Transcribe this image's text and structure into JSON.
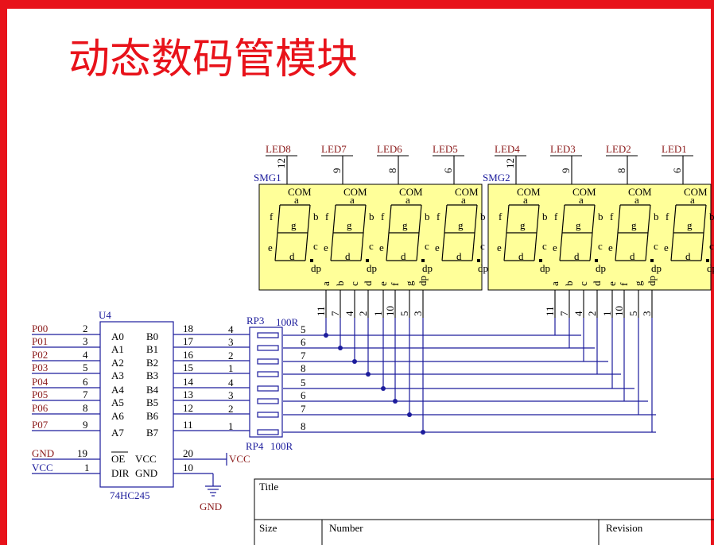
{
  "page_title": "动态数码管模块",
  "displays": [
    {
      "name": "SMG1",
      "leds": [
        "LED8",
        "LED7",
        "LED6",
        "LED5"
      ],
      "com_pins": [
        "12",
        "9",
        "8",
        "6"
      ]
    },
    {
      "name": "SMG2",
      "leds": [
        "LED4",
        "LED3",
        "LED2",
        "LED1"
      ],
      "com_pins": [
        "12",
        "9",
        "8",
        "6"
      ]
    }
  ],
  "digit_labels": {
    "com": "COM",
    "a": "a",
    "b": "b",
    "c": "c",
    "d": "d",
    "e": "e",
    "f": "f",
    "g": "g",
    "dp": "dp"
  },
  "segment_pins": [
    {
      "seg": "a",
      "pin": "11"
    },
    {
      "seg": "b",
      "pin": "7"
    },
    {
      "seg": "c",
      "pin": "4"
    },
    {
      "seg": "d",
      "pin": "2"
    },
    {
      "seg": "e",
      "pin": "1"
    },
    {
      "seg": "f",
      "pin": "10"
    },
    {
      "seg": "g",
      "pin": "5"
    },
    {
      "seg": "dp",
      "pin": "3"
    }
  ],
  "chip": {
    "ref": "U4",
    "part": "74HC245",
    "left_pins": [
      {
        "net": "P00",
        "num": "2",
        "name": "A0"
      },
      {
        "net": "P01",
        "num": "3",
        "name": "A1"
      },
      {
        "net": "P02",
        "num": "4",
        "name": "A2"
      },
      {
        "net": "P03",
        "num": "5",
        "name": "A3"
      },
      {
        "net": "P04",
        "num": "6",
        "name": "A4"
      },
      {
        "net": "P05",
        "num": "7",
        "name": "A5"
      },
      {
        "net": "P06",
        "num": "8",
        "name": "A6"
      },
      {
        "net": "P07",
        "num": "9",
        "name": "A7"
      }
    ],
    "right_pins": [
      {
        "num": "18",
        "name": "B0"
      },
      {
        "num": "17",
        "name": "B1"
      },
      {
        "num": "16",
        "name": "B2"
      },
      {
        "num": "15",
        "name": "B3"
      },
      {
        "num": "14",
        "name": "B4"
      },
      {
        "num": "13",
        "name": "B5"
      },
      {
        "num": "12",
        "name": "B6"
      },
      {
        "num": "11",
        "name": "B7"
      }
    ],
    "oe": {
      "net": "GND",
      "num": "19",
      "name": "OE"
    },
    "dir": {
      "net": "VCC",
      "num": "1",
      "name": "DIR"
    },
    "vcc": {
      "num": "20",
      "name": "VCC"
    },
    "gnd": {
      "num": "10",
      "name": "GND"
    }
  },
  "resistor_networks": [
    {
      "ref": "RP3",
      "value": "100R",
      "in_pins": [
        "4",
        "3",
        "2",
        "1"
      ],
      "out_pins": [
        "5",
        "6",
        "7",
        "8"
      ]
    },
    {
      "ref": "RP4",
      "value": "100R",
      "in_pins": [
        "4",
        "3",
        "2",
        "1"
      ],
      "out_pins": [
        "5",
        "6",
        "7",
        "8"
      ]
    }
  ],
  "power": {
    "vcc": "VCC",
    "gnd": "GND"
  },
  "title_block": {
    "title_label": "Title",
    "size_label": "Size",
    "number_label": "Number",
    "revision_label": "Revision"
  },
  "colors": {
    "frame": "#e8121a",
    "wire": "#1c1c9c",
    "net_label": "#8b1a1a",
    "display_fill": "#ffff99",
    "junction": "#1c1c9c"
  }
}
